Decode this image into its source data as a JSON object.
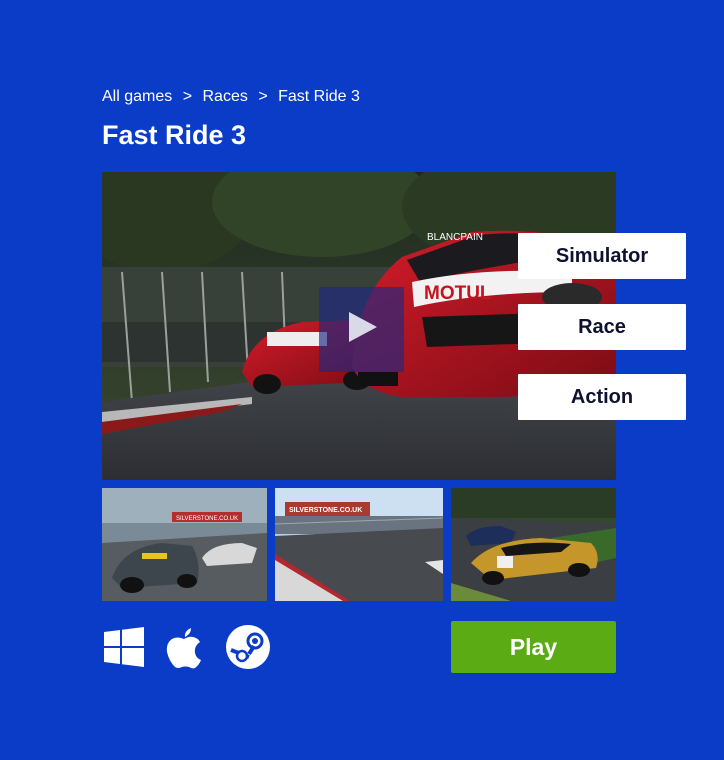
{
  "breadcrumb": {
    "items": [
      "All games",
      "Races",
      "Fast Ride 3"
    ],
    "separator": ">"
  },
  "game": {
    "title": "Fast Ride 3"
  },
  "hero": {
    "car_livery": "MOTUL",
    "sponsor": "BLANCPAIN"
  },
  "tags": [
    "Simulator",
    "Race",
    "Action"
  ],
  "thumbnails": {
    "t1": {
      "sign": "SILVERSTONE.CO.UK"
    },
    "t2": {
      "sign": "SILVERSTONE.CO.UK"
    },
    "t3": {
      "sign": ""
    }
  },
  "platforms": [
    "windows-icon",
    "apple-icon",
    "steam-icon"
  ],
  "actions": {
    "play_label": "Play"
  },
  "colors": {
    "background": "#0a3cc8",
    "play_button": "#5aab14",
    "tag_bg": "#ffffff",
    "tag_text": "#0e1230"
  }
}
